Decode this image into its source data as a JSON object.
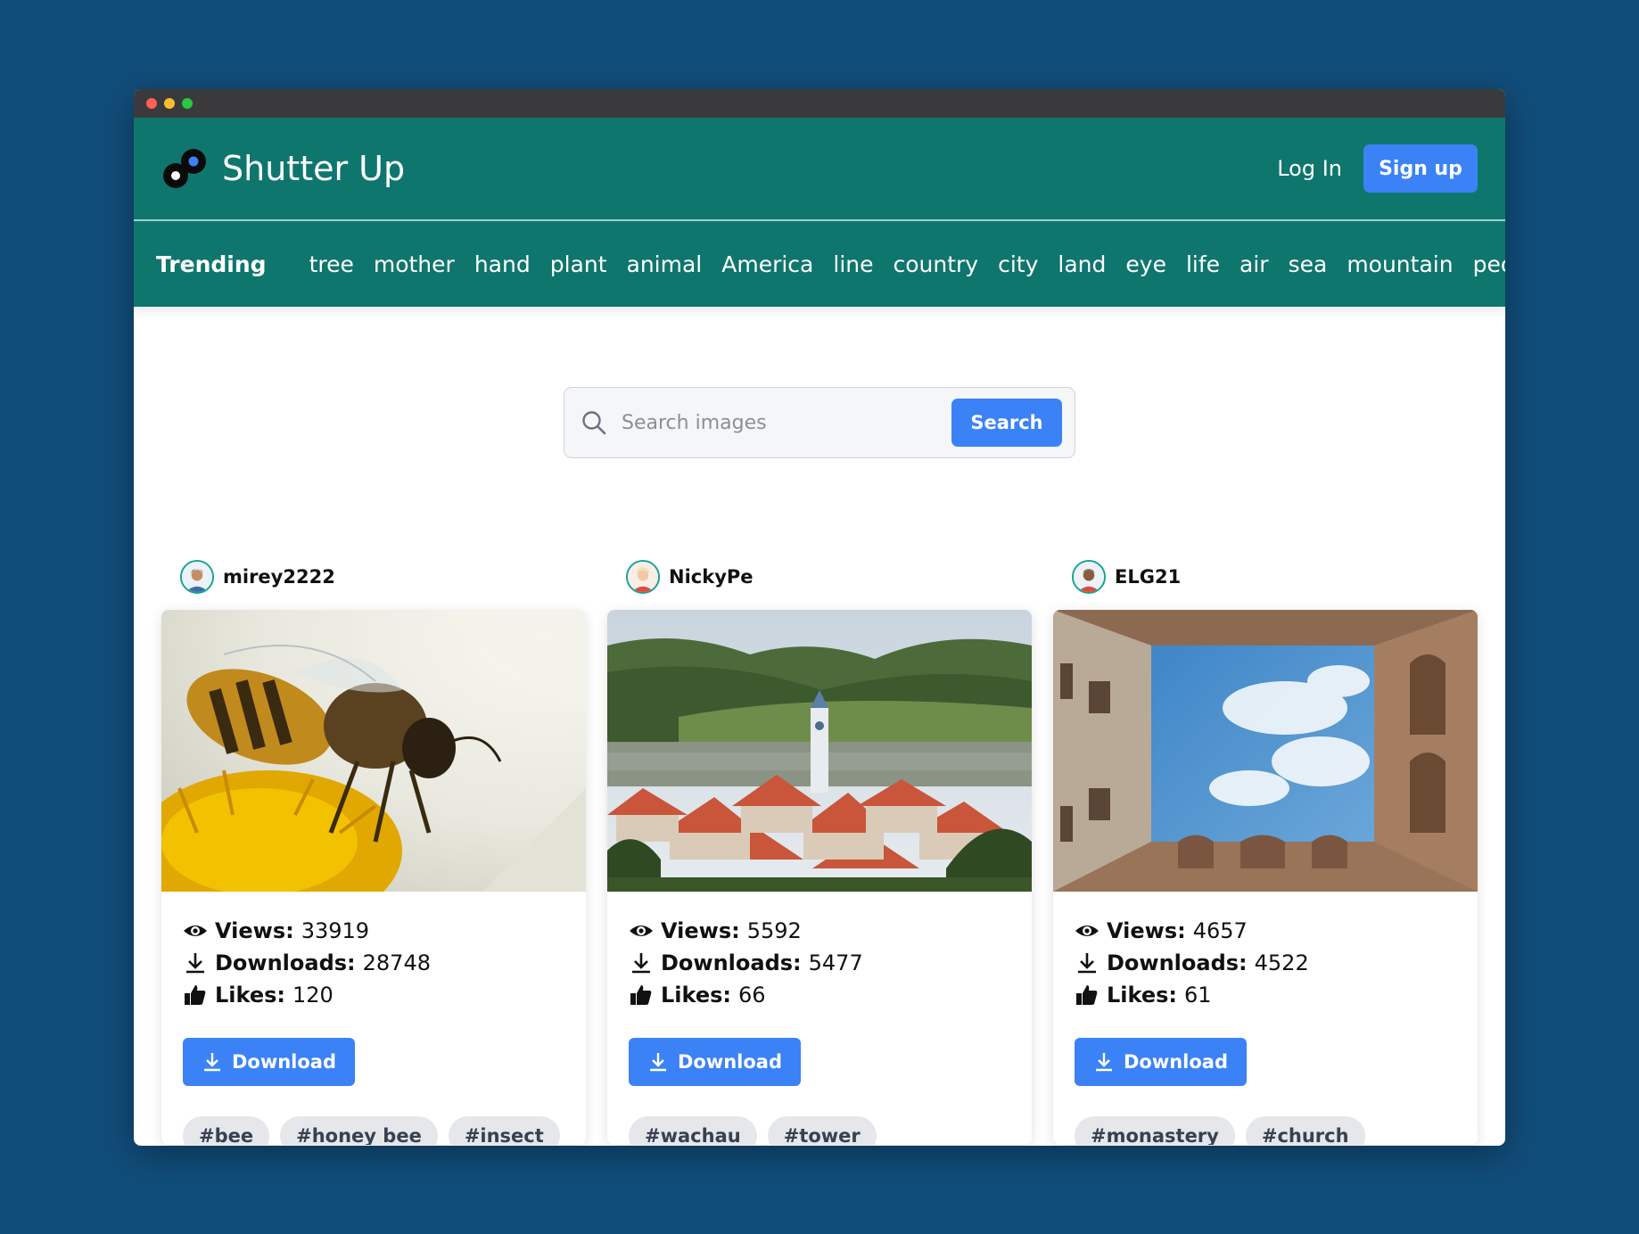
{
  "app": {
    "brand": "Shutter Up",
    "login_label": "Log In",
    "signup_label": "Sign up"
  },
  "trending": {
    "title": "Trending",
    "tags": [
      "tree",
      "mother",
      "hand",
      "plant",
      "animal",
      "America",
      "line",
      "country",
      "city",
      "land",
      "eye",
      "life",
      "air",
      "sea",
      "mountain",
      "people"
    ]
  },
  "search": {
    "placeholder": "Search images",
    "button_label": "Search"
  },
  "labels": {
    "views": "Views:",
    "downloads": "Downloads:",
    "likes": "Likes:",
    "download_button": "Download"
  },
  "cards": [
    {
      "author": "mirey2222",
      "views": "33919",
      "downloads": "28748",
      "likes": "120",
      "tags": [
        "#bee",
        "#honey bee",
        "#insect"
      ]
    },
    {
      "author": "NickyPe",
      "views": "5592",
      "downloads": "5477",
      "likes": "66",
      "tags": [
        "#wachau",
        "#tower"
      ]
    },
    {
      "author": "ELG21",
      "views": "4657",
      "downloads": "4522",
      "likes": "61",
      "tags": [
        "#monastery",
        "#church"
      ]
    }
  ],
  "colors": {
    "page_bg": "#114d7a",
    "header_teal": "#0f766e",
    "accent_blue": "#3b82f6",
    "chip_bg": "#e5e7eb"
  }
}
